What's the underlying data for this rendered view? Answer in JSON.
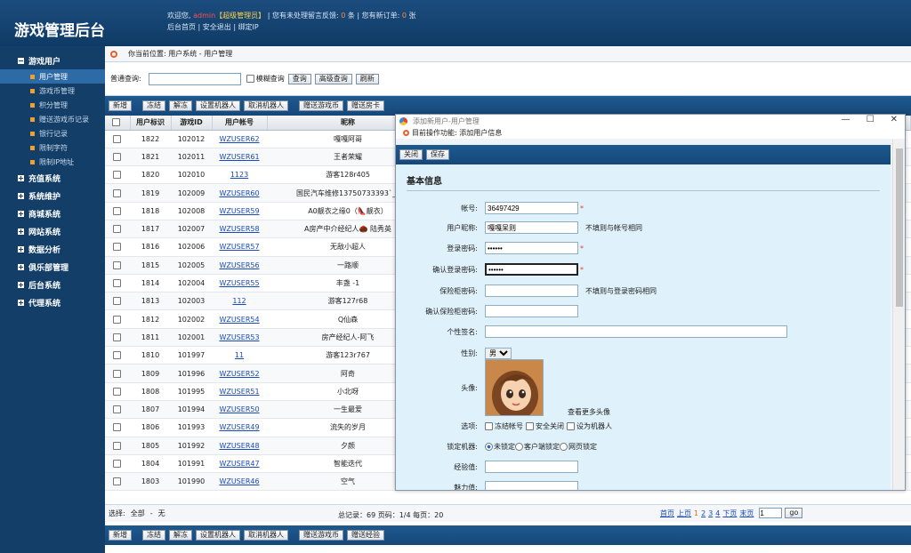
{
  "app": {
    "title": "游戏管理后台"
  },
  "header": {
    "welcome_prefix": "欢迎您,",
    "user": "admin",
    "role": "【超级管理员】",
    "msg1": "您有未处理留言反馈:",
    "count1": "0",
    "unit1": "条",
    "msg2": "您有新订单:",
    "count2": "0",
    "unit2": "张",
    "link_home": "后台首页",
    "link_logout": "安全退出",
    "link_bind": "绑定IP"
  },
  "sidebar": {
    "groups": [
      {
        "label": "游戏用户",
        "expanded": true
      },
      {
        "label": "充值系统"
      },
      {
        "label": "系统维护"
      },
      {
        "label": "商城系统"
      },
      {
        "label": "网站系统"
      },
      {
        "label": "数据分析"
      },
      {
        "label": "俱乐部管理"
      },
      {
        "label": "后台系统"
      },
      {
        "label": "代理系统"
      }
    ],
    "items": [
      {
        "label": "用户管理",
        "active": true
      },
      {
        "label": "游戏币管理"
      },
      {
        "label": "积分管理"
      },
      {
        "label": "赠送游戏币记录"
      },
      {
        "label": "银行记录"
      },
      {
        "label": "限制字符"
      },
      {
        "label": "限制IP地址"
      }
    ]
  },
  "breadcrumb": "你当前位置: 用户系统 - 用户管理",
  "search": {
    "label": "普通查询:",
    "value": "",
    "fuzzy_label": "模糊查询",
    "btn_query": "查询",
    "btn_advanced": "高级查询",
    "btn_refresh": "刷新"
  },
  "toolbar": {
    "btn_add": "新增",
    "btn_freeze": "冻结",
    "btn_unfreeze": "解冻",
    "btn_set_robot": "设置机器人",
    "btn_cancel_robot": "取消机器人",
    "btn_gift_coin": "赠送游戏币",
    "btn_gift_room": "赠送房卡",
    "btn_gift_exp": "赠送经验"
  },
  "table": {
    "headers": [
      "用户标识",
      "游戏ID",
      "用户帐号",
      "昵称"
    ],
    "rows": [
      [
        "1822",
        "102012",
        "WZUSER62",
        "嘎嘎阿哥"
      ],
      [
        "1821",
        "102011",
        "WZUSER61",
        "王者荣耀"
      ],
      [
        "1820",
        "102010",
        "1123",
        "游客128r405"
      ],
      [
        "1819",
        "102009",
        "WZUSER60",
        "国民汽车维修13750733393`_`"
      ],
      [
        "1818",
        "102008",
        "WZUSER59",
        "A0靓衣之缘0（👠靓衣）"
      ],
      [
        "1817",
        "102007",
        "WZUSER58",
        "A房产中介经纪人🌰 陆秀英"
      ],
      [
        "1816",
        "102006",
        "WZUSER57",
        "无敌小超人"
      ],
      [
        "1815",
        "102005",
        "WZUSER56",
        "一路顺"
      ],
      [
        "1814",
        "102004",
        "WZUSER55",
        "丰盏 -1"
      ],
      [
        "1813",
        "102003",
        "112",
        "游客127r68"
      ],
      [
        "1812",
        "102002",
        "WZUSER54",
        "Q仙森"
      ],
      [
        "1811",
        "102001",
        "WZUSER53",
        "房产经纪人-阿飞"
      ],
      [
        "1810",
        "101997",
        "11",
        "游客123r767"
      ],
      [
        "1809",
        "101996",
        "WZUSER52",
        "阿奇"
      ],
      [
        "1808",
        "101995",
        "WZUSER51",
        "小北呀"
      ],
      [
        "1807",
        "101994",
        "WZUSER50",
        "一生最爱"
      ],
      [
        "1806",
        "101993",
        "WZUSER49",
        "流失的岁月"
      ],
      [
        "1805",
        "101992",
        "WZUSER48",
        "夕颜"
      ],
      [
        "1804",
        "101991",
        "WZUSER47",
        "智能迭代"
      ],
      [
        "1803",
        "101990",
        "WZUSER46",
        "空气"
      ]
    ]
  },
  "footer": {
    "select_label": "选择:",
    "select_all": "全部",
    "sep": "-",
    "select_none": "无",
    "summary": "总记录：69   页码：1/4   每页：20",
    "first": "首页",
    "prev": "上页",
    "pages": [
      "1",
      "2",
      "3",
      "4"
    ],
    "next": "下页",
    "last": "末页",
    "page_input": "1",
    "go": "go"
  },
  "popup": {
    "window_title": "添加新用户-用户管理",
    "operation": "目前操作功能: 添加用户信息",
    "btn_close": "关闭",
    "btn_save": "保存",
    "section": "基本信息",
    "fields": {
      "account_label": "帐号:",
      "account_value": "36497429",
      "nickname_label": "用户昵称:",
      "nickname_value": "嘎嘎呆则",
      "nickname_hint": "不填则与帐号相同",
      "pwd_label": "登录密码:",
      "pwd_value": "••••••",
      "pwd2_label": "确认登录密码:",
      "pwd2_value": "••••••",
      "safe_label": "保险柜密码:",
      "safe_hint": "不填则与登录密码相同",
      "safe2_label": "确认保险柜密码:",
      "sign_label": "个性签名:",
      "gender_label": "性别:",
      "gender_value": "男",
      "avatar_label": "头像:",
      "avatar_more": "查看更多头像",
      "options_label": "选项:",
      "opt1": "冻结帐号",
      "opt2": "安全关闭",
      "opt3": "设为机器人",
      "lock_label": "锁定机器:",
      "lock1": "未锁定",
      "lock2": "客户端锁定",
      "lock3": "网页锁定",
      "exp_label": "经验值:",
      "charm_label": "魅力值:"
    }
  }
}
